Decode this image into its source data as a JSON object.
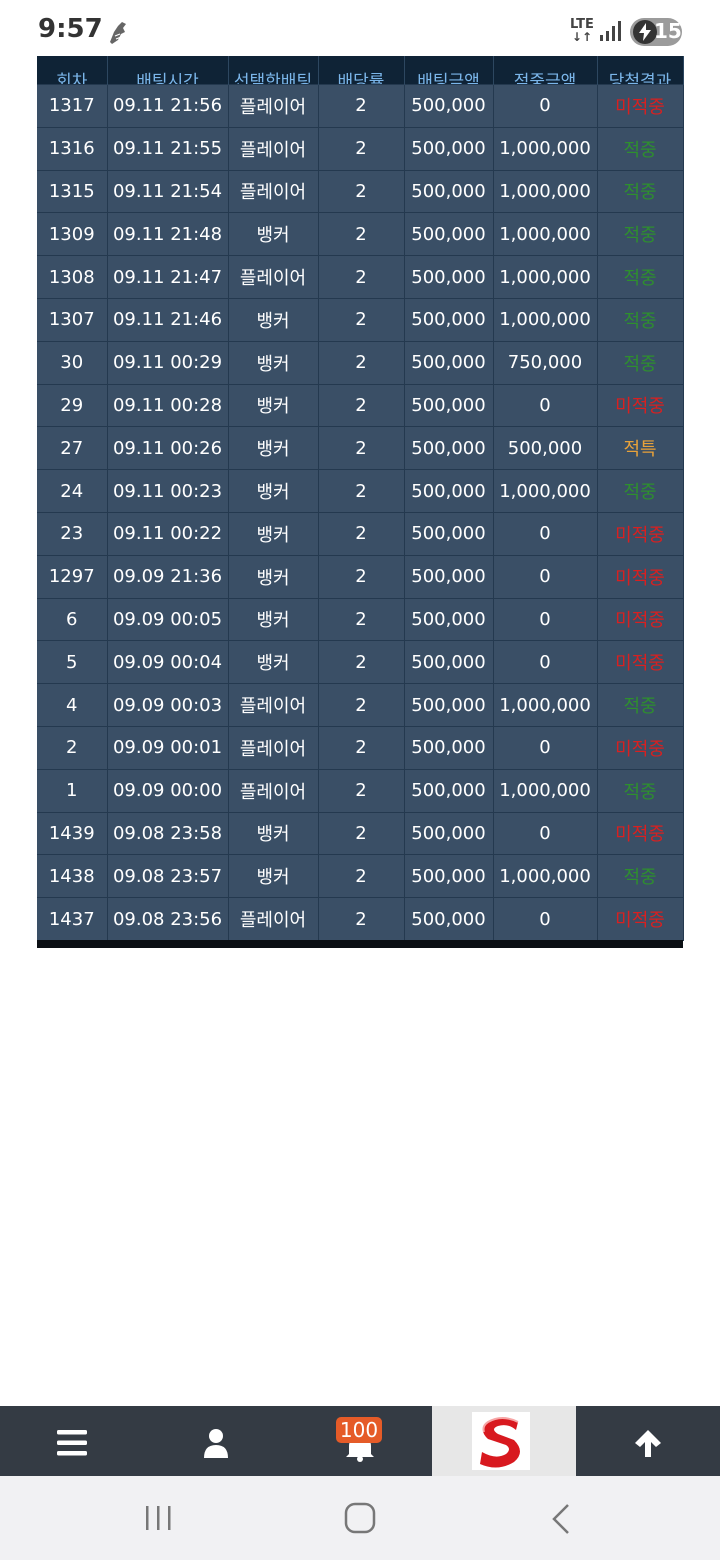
{
  "status_bar": {
    "time": "9:57",
    "network": "LTE",
    "battery": "15",
    "icons": [
      "running-shoe-icon",
      "signal-icon",
      "charging-bolt-icon"
    ]
  },
  "table": {
    "headers": [
      "회차",
      "배팅시간",
      "선택한배팅",
      "배당률",
      "배팅금액",
      "적중금액",
      "당첨결과"
    ],
    "rows": [
      {
        "round": "1317",
        "time": "09.11 21:56",
        "pick": "플레이어",
        "odds": "2",
        "bet": "500,000",
        "win": "0",
        "result": "미적중",
        "status": "miss"
      },
      {
        "round": "1316",
        "time": "09.11 21:55",
        "pick": "플레이어",
        "odds": "2",
        "bet": "500,000",
        "win": "1,000,000",
        "result": "적중",
        "status": "hit"
      },
      {
        "round": "1315",
        "time": "09.11 21:54",
        "pick": "플레이어",
        "odds": "2",
        "bet": "500,000",
        "win": "1,000,000",
        "result": "적중",
        "status": "hit"
      },
      {
        "round": "1309",
        "time": "09.11 21:48",
        "pick": "뱅커",
        "odds": "2",
        "bet": "500,000",
        "win": "1,000,000",
        "result": "적중",
        "status": "hit"
      },
      {
        "round": "1308",
        "time": "09.11 21:47",
        "pick": "플레이어",
        "odds": "2",
        "bet": "500,000",
        "win": "1,000,000",
        "result": "적중",
        "status": "hit"
      },
      {
        "round": "1307",
        "time": "09.11 21:46",
        "pick": "뱅커",
        "odds": "2",
        "bet": "500,000",
        "win": "1,000,000",
        "result": "적중",
        "status": "hit"
      },
      {
        "round": "30",
        "time": "09.11 00:29",
        "pick": "뱅커",
        "odds": "2",
        "bet": "500,000",
        "win": "750,000",
        "result": "적중",
        "status": "hit"
      },
      {
        "round": "29",
        "time": "09.11 00:28",
        "pick": "뱅커",
        "odds": "2",
        "bet": "500,000",
        "win": "0",
        "result": "미적중",
        "status": "miss"
      },
      {
        "round": "27",
        "time": "09.11 00:26",
        "pick": "뱅커",
        "odds": "2",
        "bet": "500,000",
        "win": "500,000",
        "result": "적특",
        "status": "special"
      },
      {
        "round": "24",
        "time": "09.11 00:23",
        "pick": "뱅커",
        "odds": "2",
        "bet": "500,000",
        "win": "1,000,000",
        "result": "적중",
        "status": "hit"
      },
      {
        "round": "23",
        "time": "09.11 00:22",
        "pick": "뱅커",
        "odds": "2",
        "bet": "500,000",
        "win": "0",
        "result": "미적중",
        "status": "miss"
      },
      {
        "round": "1297",
        "time": "09.09 21:36",
        "pick": "뱅커",
        "odds": "2",
        "bet": "500,000",
        "win": "0",
        "result": "미적중",
        "status": "miss"
      },
      {
        "round": "6",
        "time": "09.09 00:05",
        "pick": "뱅커",
        "odds": "2",
        "bet": "500,000",
        "win": "0",
        "result": "미적중",
        "status": "miss"
      },
      {
        "round": "5",
        "time": "09.09 00:04",
        "pick": "뱅커",
        "odds": "2",
        "bet": "500,000",
        "win": "0",
        "result": "미적중",
        "status": "miss"
      },
      {
        "round": "4",
        "time": "09.09 00:03",
        "pick": "플레이어",
        "odds": "2",
        "bet": "500,000",
        "win": "1,000,000",
        "result": "적중",
        "status": "hit"
      },
      {
        "round": "2",
        "time": "09.09 00:01",
        "pick": "플레이어",
        "odds": "2",
        "bet": "500,000",
        "win": "0",
        "result": "미적중",
        "status": "miss"
      },
      {
        "round": "1",
        "time": "09.09 00:00",
        "pick": "플레이어",
        "odds": "2",
        "bet": "500,000",
        "win": "1,000,000",
        "result": "적중",
        "status": "hit"
      },
      {
        "round": "1439",
        "time": "09.08 23:58",
        "pick": "뱅커",
        "odds": "2",
        "bet": "500,000",
        "win": "0",
        "result": "미적중",
        "status": "miss"
      },
      {
        "round": "1438",
        "time": "09.08 23:57",
        "pick": "뱅커",
        "odds": "2",
        "bet": "500,000",
        "win": "1,000,000",
        "result": "적중",
        "status": "hit"
      },
      {
        "round": "1437",
        "time": "09.08 23:56",
        "pick": "플레이어",
        "odds": "2",
        "bet": "500,000",
        "win": "0",
        "result": "미적중",
        "status": "miss"
      }
    ]
  },
  "bottom_nav": {
    "items": [
      "menu-icon",
      "user-icon",
      "bell-icon",
      "site-logo",
      "arrow-up-icon"
    ],
    "notification_count": "100"
  },
  "system_nav": {
    "items": [
      "recent-apps-button",
      "home-button",
      "back-button"
    ]
  },
  "colors": {
    "table_header_bg": "#0f2336",
    "table_header_text": "#7bb6ea",
    "table_row_bg": "#3a4f66",
    "result_miss": "#d82020",
    "result_hit": "#2e8f2e",
    "result_special": "#e8a23a",
    "nav_bg": "#343b44",
    "badge": "#e55b28"
  }
}
